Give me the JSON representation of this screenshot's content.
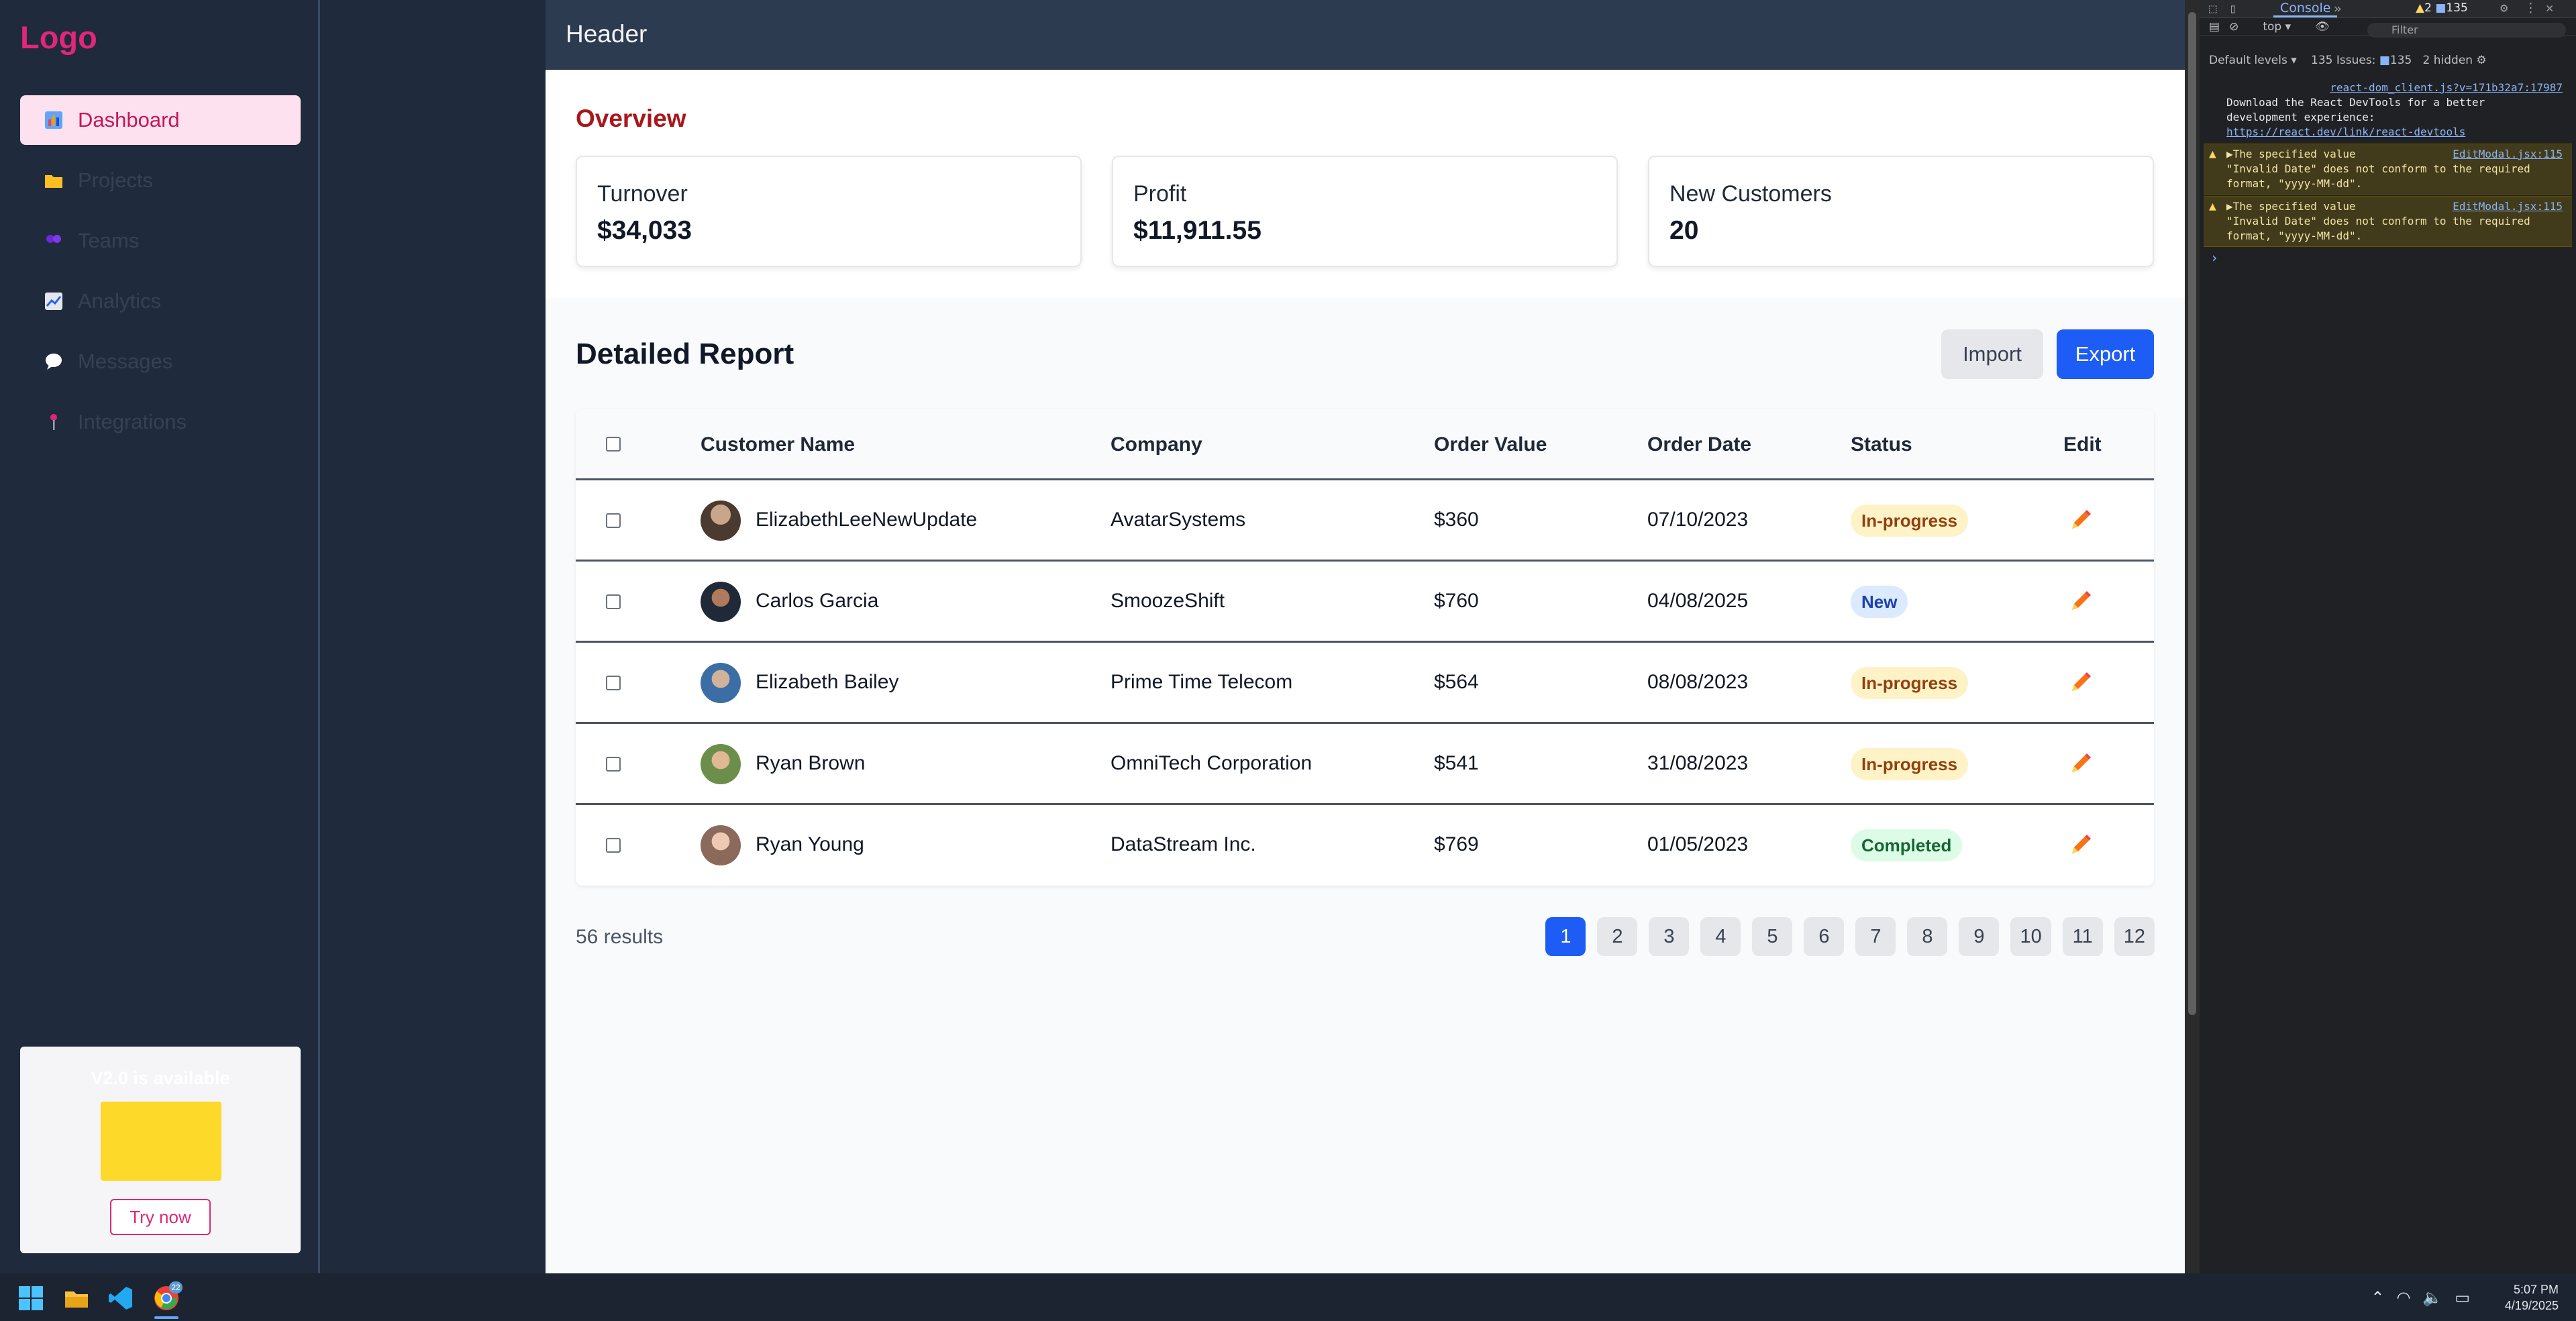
{
  "sidebar": {
    "logo": "Logo",
    "items": [
      {
        "label": "Dashboard",
        "icon": "bar-chart-icon"
      },
      {
        "label": "Projects",
        "icon": "folder-icon"
      },
      {
        "label": "Teams",
        "icon": "people-icon"
      },
      {
        "label": "Analytics",
        "icon": "line-chart-icon"
      },
      {
        "label": "Messages",
        "icon": "speech-bubble-icon"
      },
      {
        "label": "Integrations",
        "icon": "pin-icon"
      }
    ],
    "promo": {
      "title": "V2.0 is available",
      "button": "Try now"
    }
  },
  "header": {
    "title": "Header"
  },
  "overview": {
    "title": "Overview",
    "cards": [
      {
        "label": "Turnover",
        "value": "$34,033"
      },
      {
        "label": "Profit",
        "value": "$11,911.55"
      },
      {
        "label": "New Customers",
        "value": "20"
      }
    ]
  },
  "report": {
    "title": "Detailed Report",
    "import_label": "Import",
    "export_label": "Export",
    "columns": [
      "Customer Name",
      "Company",
      "Order Value",
      "Order Date",
      "Status",
      "Edit"
    ],
    "rows": [
      {
        "name": "ElizabethLeeNewUpdate",
        "company": "AvatarSystems",
        "value": "$360",
        "date": "07/10/2023",
        "status": "In-progress"
      },
      {
        "name": "Carlos Garcia",
        "company": "SmoozeShift",
        "value": "$760",
        "date": "04/08/2025",
        "status": "New"
      },
      {
        "name": "Elizabeth Bailey",
        "company": "Prime Time Telecom",
        "value": "$564",
        "date": "08/08/2023",
        "status": "In-progress"
      },
      {
        "name": "Ryan Brown",
        "company": "OmniTech Corporation",
        "value": "$541",
        "date": "31/08/2023",
        "status": "In-progress"
      },
      {
        "name": "Ryan Young",
        "company": "DataStream Inc.",
        "value": "$769",
        "date": "01/05/2023",
        "status": "Completed"
      }
    ],
    "results": "56 results",
    "pages": [
      "1",
      "2",
      "3",
      "4",
      "5",
      "6",
      "7",
      "8",
      "9",
      "10",
      "11",
      "12"
    ],
    "current_page": "1"
  },
  "devtools": {
    "tab": "Console",
    "warn_count": "2",
    "issue_count": "135",
    "context": "top ▾",
    "filter_placeholder": "Filter",
    "levels": "Default levels ▾",
    "issues_label": "135 Issues:",
    "issues_count": "135",
    "hidden": "2 hidden",
    "info_source": "react-dom_client.js?v=171b32a7:17987",
    "info_text": "Download the React DevTools for a better development experience:",
    "info_link": "https://react.dev/link/react-devtools",
    "warnings": [
      {
        "source": "EditModal.jsx:115",
        "text1": "▶The specified value",
        "text2": "\"Invalid Date\" does not conform to the required",
        "text3": "format, \"yyyy-MM-dd\"."
      },
      {
        "source": "EditModal.jsx:115",
        "text1": "▶The specified value",
        "text2": "\"Invalid Date\" does not conform to the required",
        "text3": "format, \"yyyy-MM-dd\"."
      }
    ],
    "prompt": "›"
  },
  "taskbar": {
    "time": "5:07 PM",
    "date": "4/19/2025",
    "chrome_badge": "22"
  },
  "colors": {
    "brand": "#e0277a",
    "primary": "#1d5cf5",
    "overview_title": "#a8171c"
  }
}
